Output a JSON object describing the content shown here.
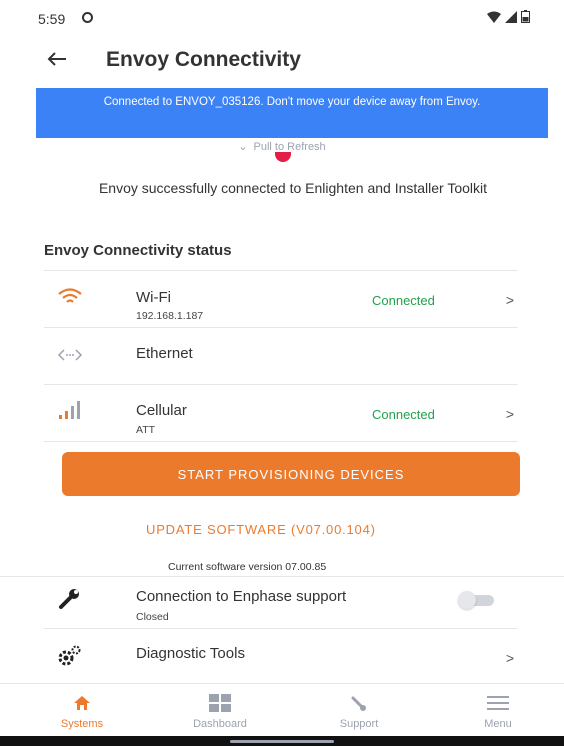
{
  "status_bar": {
    "time": "5:59"
  },
  "header": {
    "title": "Envoy Connectivity"
  },
  "banner": {
    "text": "Connected to ENVOY_035126. Don't move your device away from Envoy."
  },
  "refresh": {
    "label": "Pull to Refresh"
  },
  "message": "Envoy successfully connected to Enlighten and Installer Toolkit",
  "connectivity": {
    "section_title": "Envoy Connectivity status",
    "items": [
      {
        "label": "Wi-Fi",
        "sublabel": "192.168.1.187",
        "status": "Connected",
        "icon": "wifi-icon"
      },
      {
        "label": "Ethernet",
        "sublabel": "",
        "status": "",
        "icon": "ethernet-icon"
      },
      {
        "label": "Cellular",
        "sublabel": "ATT",
        "status": "Connected",
        "icon": "cellular-signal-icon"
      }
    ]
  },
  "actions": {
    "provision_label": "START PROVISIONING DEVICES",
    "update_label": "UPDATE SOFTWARE (V07.00.104)",
    "current_version": "Current software version 07.00.85"
  },
  "support": {
    "label": "Connection to Enphase support",
    "status": "Closed",
    "toggle_on": false
  },
  "diagnostics": {
    "label": "Diagnostic Tools"
  },
  "bottom_nav": {
    "items": [
      {
        "label": "Systems",
        "icon": "home-icon",
        "active": true
      },
      {
        "label": "Dashboard",
        "icon": "dashboard-icon",
        "active": false
      },
      {
        "label": "Support",
        "icon": "wrench-icon",
        "active": false
      },
      {
        "label": "Menu",
        "icon": "hamburger-menu-icon",
        "active": false
      }
    ]
  },
  "colors": {
    "accent": "#ec7a2d",
    "banner": "#3b82f6",
    "status_ok": "#22a24a"
  }
}
